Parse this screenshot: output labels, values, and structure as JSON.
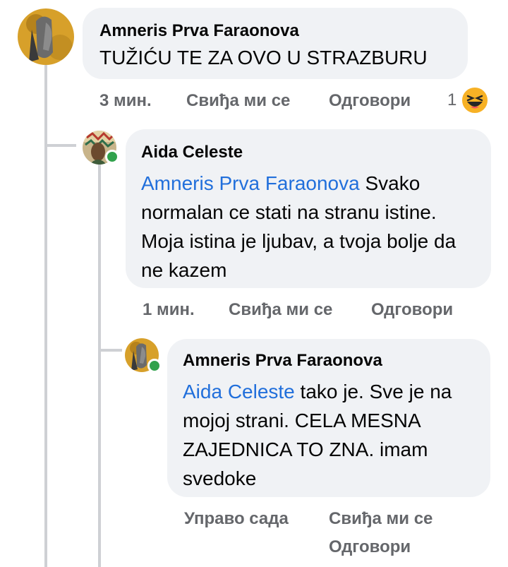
{
  "comments": [
    {
      "author": "Amneris Prva Faraonova",
      "text": "TUŽIĆU TE ZA OVO U STRAZBURU",
      "time": "3 мин.",
      "like_label": "Свиђа ми се",
      "reply_label": "Одговори",
      "reaction_count": "1",
      "reaction_icon": "haha-emoji-icon"
    },
    {
      "author": "Aida Celeste",
      "mention": "Amneris Prva Faraonova",
      "text": " Svako normalan ce stati na stranu istine. Moja istina je ljubav, a tvoja bolje da ne kazem",
      "time": "1 мин.",
      "like_label": "Свиђа ми се",
      "reply_label": "Одговори",
      "online": true
    },
    {
      "author": "Amneris Prva Faraonova",
      "mention": "Aida Celeste",
      "text": " tako je. Sve je na mojoj strani. CELA MESNA ZAJEDNICA TO ZNA. imam svedoke",
      "time": "Управо сада",
      "like_label": "Свиђа ми се",
      "reply_label": "Одговори",
      "online": true
    }
  ],
  "colors": {
    "bubble": "#f0f2f5",
    "meta_text": "#65676b",
    "mention": "#216fdb",
    "online": "#31a24c",
    "thread_line": "#ced0d4"
  }
}
